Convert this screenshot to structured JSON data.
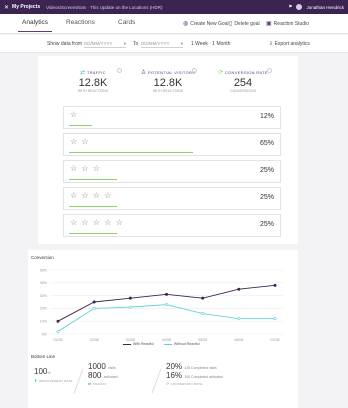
{
  "topbar": {
    "logo": "✕",
    "project": "My Projects",
    "breadcrumb": "Videos/Screenshots · This Update on the Locations (HDR)",
    "user": "Jonathan Hendrick"
  },
  "tabs": [
    {
      "label": "Analytics"
    },
    {
      "label": "Reactions"
    },
    {
      "label": "Cards"
    }
  ],
  "actions": {
    "create_goal": "Create New Goal",
    "delete_goal": "Delete goal",
    "reaction_studio": "Reaction Studio"
  },
  "filters": {
    "show_from_label": "Show data from",
    "from_placeholder": "DD/MM/YYYY",
    "to_label": "To",
    "to_placeholder": "DD/MM/YYYY",
    "presets": "1 Week · 1 Month",
    "export": "Export analytics"
  },
  "stats": [
    {
      "label": "TRAFFIC",
      "value": "12.8K",
      "sub": "WITH REACTIONS",
      "icon": "arrows-icon"
    },
    {
      "label": "POTENTIAL VISITORS",
      "value": "12.8K",
      "sub": "WITH REACTIONS",
      "icon": "person-icon"
    },
    {
      "label": "CONVERSION RATE",
      "value": "254",
      "sub": "CONVERSIONS",
      "icon": "refresh-icon"
    }
  ],
  "ratings": [
    {
      "stars": 1,
      "stars_text": "☆",
      "percent": "12%",
      "fraction": 0.12
    },
    {
      "stars": 2,
      "stars_text": "☆ ☆",
      "percent": "65%",
      "fraction": 0.65
    },
    {
      "stars": 3,
      "stars_text": "☆ ☆ ☆",
      "percent": "25%",
      "fraction": 0.25
    },
    {
      "stars": 4,
      "stars_text": "☆ ☆ ☆ ☆",
      "percent": "25%",
      "fraction": 0.25
    },
    {
      "stars": 5,
      "stars_text": "☆ ☆ ☆ ☆ ☆",
      "percent": "25%",
      "fraction": 0.25
    }
  ],
  "chart_data": {
    "type": "line",
    "title": "Conversion",
    "categories": [
      "01/08",
      "02/08",
      "03/08",
      "04/08",
      "05/08",
      "06/08",
      "07/08"
    ],
    "yticks": [
      "50%",
      "40%",
      "30%",
      "20%",
      "10%",
      "0%"
    ],
    "ylim": [
      0,
      50
    ],
    "grid": true,
    "legend_position": "bottom",
    "series": [
      {
        "name": "With Reactful",
        "color": "#3b2451",
        "values": [
          10,
          25,
          28,
          31,
          28,
          35,
          38
        ]
      },
      {
        "name": "Without Reactful",
        "color": "#5fd3dc",
        "values": [
          2,
          20,
          21,
          23,
          16,
          12,
          12
        ]
      }
    ]
  },
  "bottom_line": {
    "title": "Bottom Line",
    "improvement_value": "100",
    "improvement_unit": "%",
    "improvement_label": "IMPROVEMENT RATE",
    "visits_value": "1000",
    "visits_unit": "visits",
    "activated_value": "800",
    "activated_unit": "activated",
    "traffic_label": "TRAFFIC",
    "rate1_value": "20%",
    "rate1_text": "125 Completed visits",
    "rate2_value": "16%",
    "rate2_text": "100 Completed activated",
    "conv_label": "CONVERSION RATE"
  },
  "colors": {
    "brand": "#3b2451",
    "accent": "#5fd3dc",
    "bar": "#8bd46d"
  }
}
